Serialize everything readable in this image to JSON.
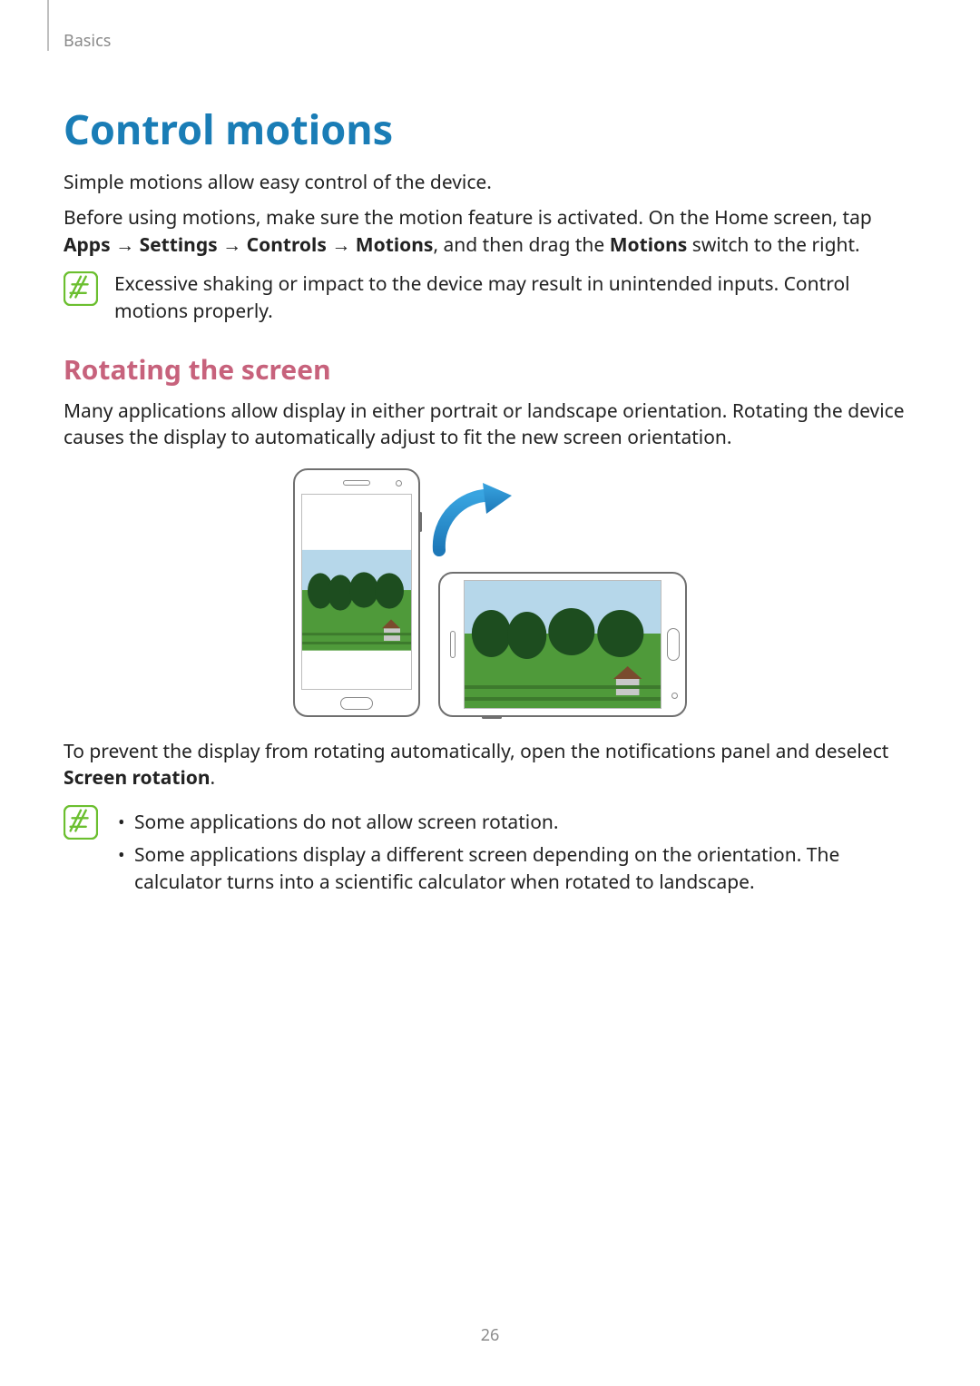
{
  "header": {
    "section": "Basics"
  },
  "title": "Control motions",
  "intro1": "Simple motions allow easy control of the device.",
  "intro2_pre": "Before using motions, make sure the motion feature is activated. On the Home screen, tap ",
  "path": {
    "apps": "Apps",
    "settings": "Settings",
    "controls": "Controls",
    "motions": "Motions"
  },
  "arrow": "→",
  "intro2_mid": ", and then drag the ",
  "intro2_bold": "Motions",
  "intro2_post": " switch to the right.",
  "note1": "Excessive shaking or impact to the device may result in unintended inputs. Control motions properly.",
  "subtitle": "Rotating the screen",
  "rot1": "Many applications allow display in either portrait or landscape orientation. Rotating the device causes the display to automatically adjust to fit the new screen orientation.",
  "rot2_pre": "To prevent the display from rotating automatically, open the notifications panel and deselect ",
  "rot2_bold": "Screen rotation",
  "rot2_post": ".",
  "note2": {
    "bullets": [
      "Some applications do not allow screen rotation.",
      "Some applications display a different screen depending on the orientation. The calculator turns into a scientific calculator when rotated to landscape."
    ]
  },
  "page": "26"
}
